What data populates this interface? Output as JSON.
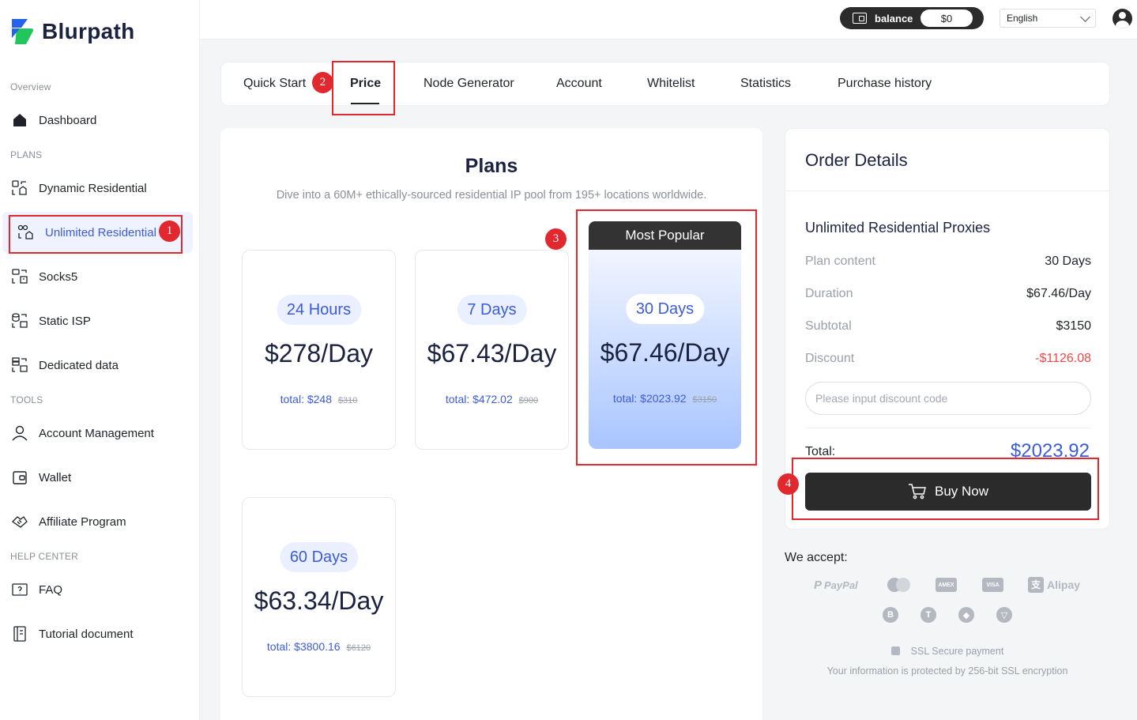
{
  "brand": {
    "name": "Blurpath"
  },
  "sidebar": {
    "sections": [
      "Overview",
      "PLANS",
      "TOOLS",
      "HELP CENTER"
    ],
    "items": [
      {
        "label": "Dashboard",
        "icon": "home-icon"
      },
      {
        "label": "Dynamic Residential",
        "icon": "residential-icon"
      },
      {
        "label": "Unlimited Residential",
        "icon": "unlimited-icon"
      },
      {
        "label": "Socks5",
        "icon": "socks5-icon"
      },
      {
        "label": "Static ISP",
        "icon": "static-isp-icon"
      },
      {
        "label": "Dedicated data",
        "icon": "dedicated-icon"
      },
      {
        "label": "Account Management",
        "icon": "user-icon"
      },
      {
        "label": "Wallet",
        "icon": "wallet-icon"
      },
      {
        "label": "Affiliate Program",
        "icon": "handshake-icon"
      },
      {
        "label": "FAQ",
        "icon": "faq-icon"
      },
      {
        "label": "Tutorial document",
        "icon": "document-icon"
      }
    ]
  },
  "topbar": {
    "balance_label": "balance",
    "balance_value": "$0",
    "language": "English"
  },
  "tabs": [
    "Quick Start",
    "Price",
    "Node Generator",
    "Account",
    "Whitelist",
    "Statistics",
    "Purchase history"
  ],
  "plans": {
    "title": "Plans",
    "subtitle": "Dive into a 60M+ ethically-sourced residential IP pool from 195+ locations worldwide.",
    "popular_label": "Most Popular",
    "cards": [
      {
        "duration": "24 Hours",
        "price": "$278/Day",
        "total_label": "total:",
        "total": "$248",
        "original": "$310"
      },
      {
        "duration": "7 Days",
        "price": "$67.43/Day",
        "total_label": "total:",
        "total": "$472.02",
        "original": "$900"
      },
      {
        "duration": "30 Days",
        "price": "$67.46/Day",
        "total_label": "total:",
        "total": "$2023.92",
        "original": "$3150"
      },
      {
        "duration": "60 Days",
        "price": "$63.34/Day",
        "total_label": "total:",
        "total": "$3800.16",
        "original": "$6120"
      }
    ]
  },
  "order": {
    "title": "Order Details",
    "product": "Unlimited Residential Proxies",
    "rows": [
      {
        "label": "Plan content",
        "value": "30 Days"
      },
      {
        "label": "Duration",
        "value": "$67.46/Day"
      },
      {
        "label": "Subtotal",
        "value": "$3150"
      },
      {
        "label": "Discount",
        "value": "-$1126.08"
      }
    ],
    "discount_placeholder": "Please input discount code",
    "total_label": "Total:",
    "total_value": "$2023.92",
    "buy_label": "Buy Now"
  },
  "payments": {
    "accept_label": "We accept:",
    "methods": [
      "PayPal",
      "AMEX",
      "VISA",
      "Alipay"
    ],
    "crypto": [
      "B",
      "T",
      "◆",
      "▽"
    ],
    "ssl_title": "SSL Secure payment",
    "ssl_note": "Your information is protected by 256-bit SSL encryption"
  },
  "annotations": [
    "1",
    "2",
    "3",
    "4"
  ],
  "colors": {
    "accent": "#3b5bdb",
    "dark": "#2b2b2b",
    "discount": "#f04747",
    "annotation": "#e0282e"
  }
}
